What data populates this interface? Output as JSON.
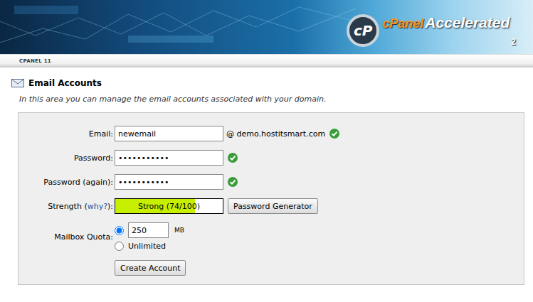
{
  "header": {
    "logo": {
      "emblem": "cP",
      "brand": "cPanel",
      "product": "Accelerated",
      "version": "2"
    },
    "version_label": "CPANEL 11"
  },
  "page": {
    "title": "Email Accounts",
    "description": "In this area you can manage the email accounts associated with your domain."
  },
  "form": {
    "email": {
      "label": "Email:",
      "value": "newemail",
      "domain": "@ demo.hostitsmart.com",
      "valid": true
    },
    "password": {
      "label": "Password:",
      "value": "•••••••••••",
      "valid": true
    },
    "password_again": {
      "label": "Password (again):",
      "value": "•••••••••••",
      "valid": true
    },
    "strength": {
      "label_start": "Strength (",
      "link": "why?",
      "label_end": "):",
      "text": "Strong (74/100)",
      "level": 0.74
    },
    "generator_button": "Password Generator",
    "quota": {
      "label": "Mailbox Quota:",
      "options": [
        {
          "kind": "input",
          "value": "250",
          "unit": "MB",
          "selected": true
        },
        {
          "kind": "text",
          "label": "Unlimited",
          "selected": false
        }
      ]
    },
    "submit": "Create Account"
  }
}
